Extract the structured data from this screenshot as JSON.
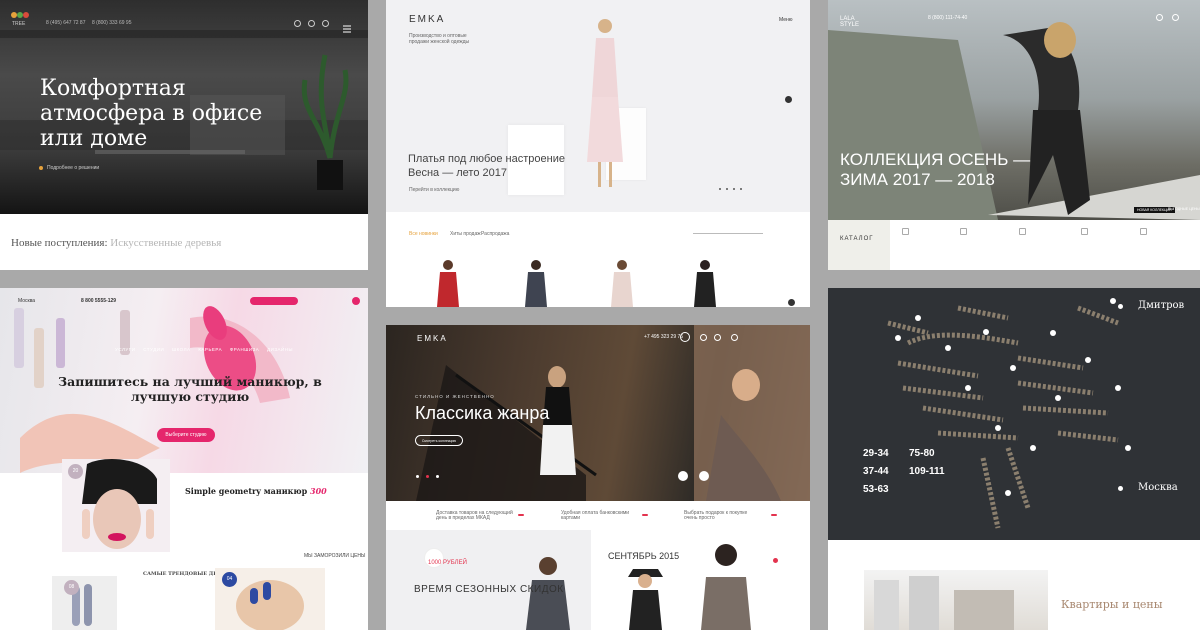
{
  "collage": {
    "p1": {
      "phones": [
        "8 (495) 647 72 87",
        "8 (800) 333 69 95"
      ],
      "hero_title": "Комфортная атмосфера в офисе или доме",
      "hero_link": "Подробнее о решении",
      "new_label": "Новые поступления:",
      "new_value": "Искусственные деревья"
    },
    "p2": {
      "logo": "EMKA",
      "tagline": "Производство и оптовые продажи женской одежды",
      "menu": "Меню",
      "hero_title": "Платья под любое настроение Весна — лето 2017",
      "hero_link": "Перейти в коллекцию",
      "tabs": [
        "Все новинки",
        "Хиты продаж",
        "Распродажа"
      ]
    },
    "p3": {
      "logo": "LALA STYLE",
      "phone": "8 (800) 111-74-40",
      "hero_title": "КОЛЛЕКЦИЯ ОСЕНЬ — ЗИМА 2017 — 2018",
      "btn1": "НОВАЯ КОЛЛЕКЦИЯ",
      "btn2": "ВЫГОДНЫЕ ЦЕНЫ",
      "catalog": "КАТАЛОГ"
    },
    "p4": {
      "city": "Москва",
      "phone": "8 800 5555-129",
      "nav": "УСЛУГИ СТУДИИ ШКОЛА КАРЬЕРА ФРАНШИЗА ДИЗАЙНЫ",
      "hero_title": "Запишитесь на лучший маникюр, в лучшую студию",
      "cta": "Выберите студию",
      "geo_title": "Simple geometry маникюр",
      "geo_price": "300",
      "design": "САМЫЕ ТРЕНДОВЫЕ ДИЗАЙНЫ",
      "frozen": "МЫ ЗАМОРОЗИЛИ ЦЕНЫ",
      "badges": [
        "20",
        "08",
        "04"
      ]
    },
    "p5": {
      "logo": "EMKA",
      "subtitle": "СТИЛЬНО И ЖЕНСТВЕННО",
      "hero_title": "Классика жанра",
      "btn": "Смотреть коллекцию",
      "phone": "+7 495 323 29 76",
      "sale_title": "ВРЕМЯ СЕЗОННЫХ СКИДОК",
      "sale_sub": "1000 РУБЛЕЙ",
      "sept": "СЕНТЯБРЬ 2015",
      "features": [
        "Доставка товаров на следующий день в пределах МКАД",
        "Удобная оплата банковскими картами",
        "Выбрать подарок к покупке очень просто"
      ]
    },
    "p6": {
      "stats": [
        "29-34",
        "75-80",
        "37-44",
        "109-111",
        "53-63"
      ],
      "city1": "Дмитров",
      "city2": "Москва",
      "prices": "Квартиры и цены"
    }
  }
}
